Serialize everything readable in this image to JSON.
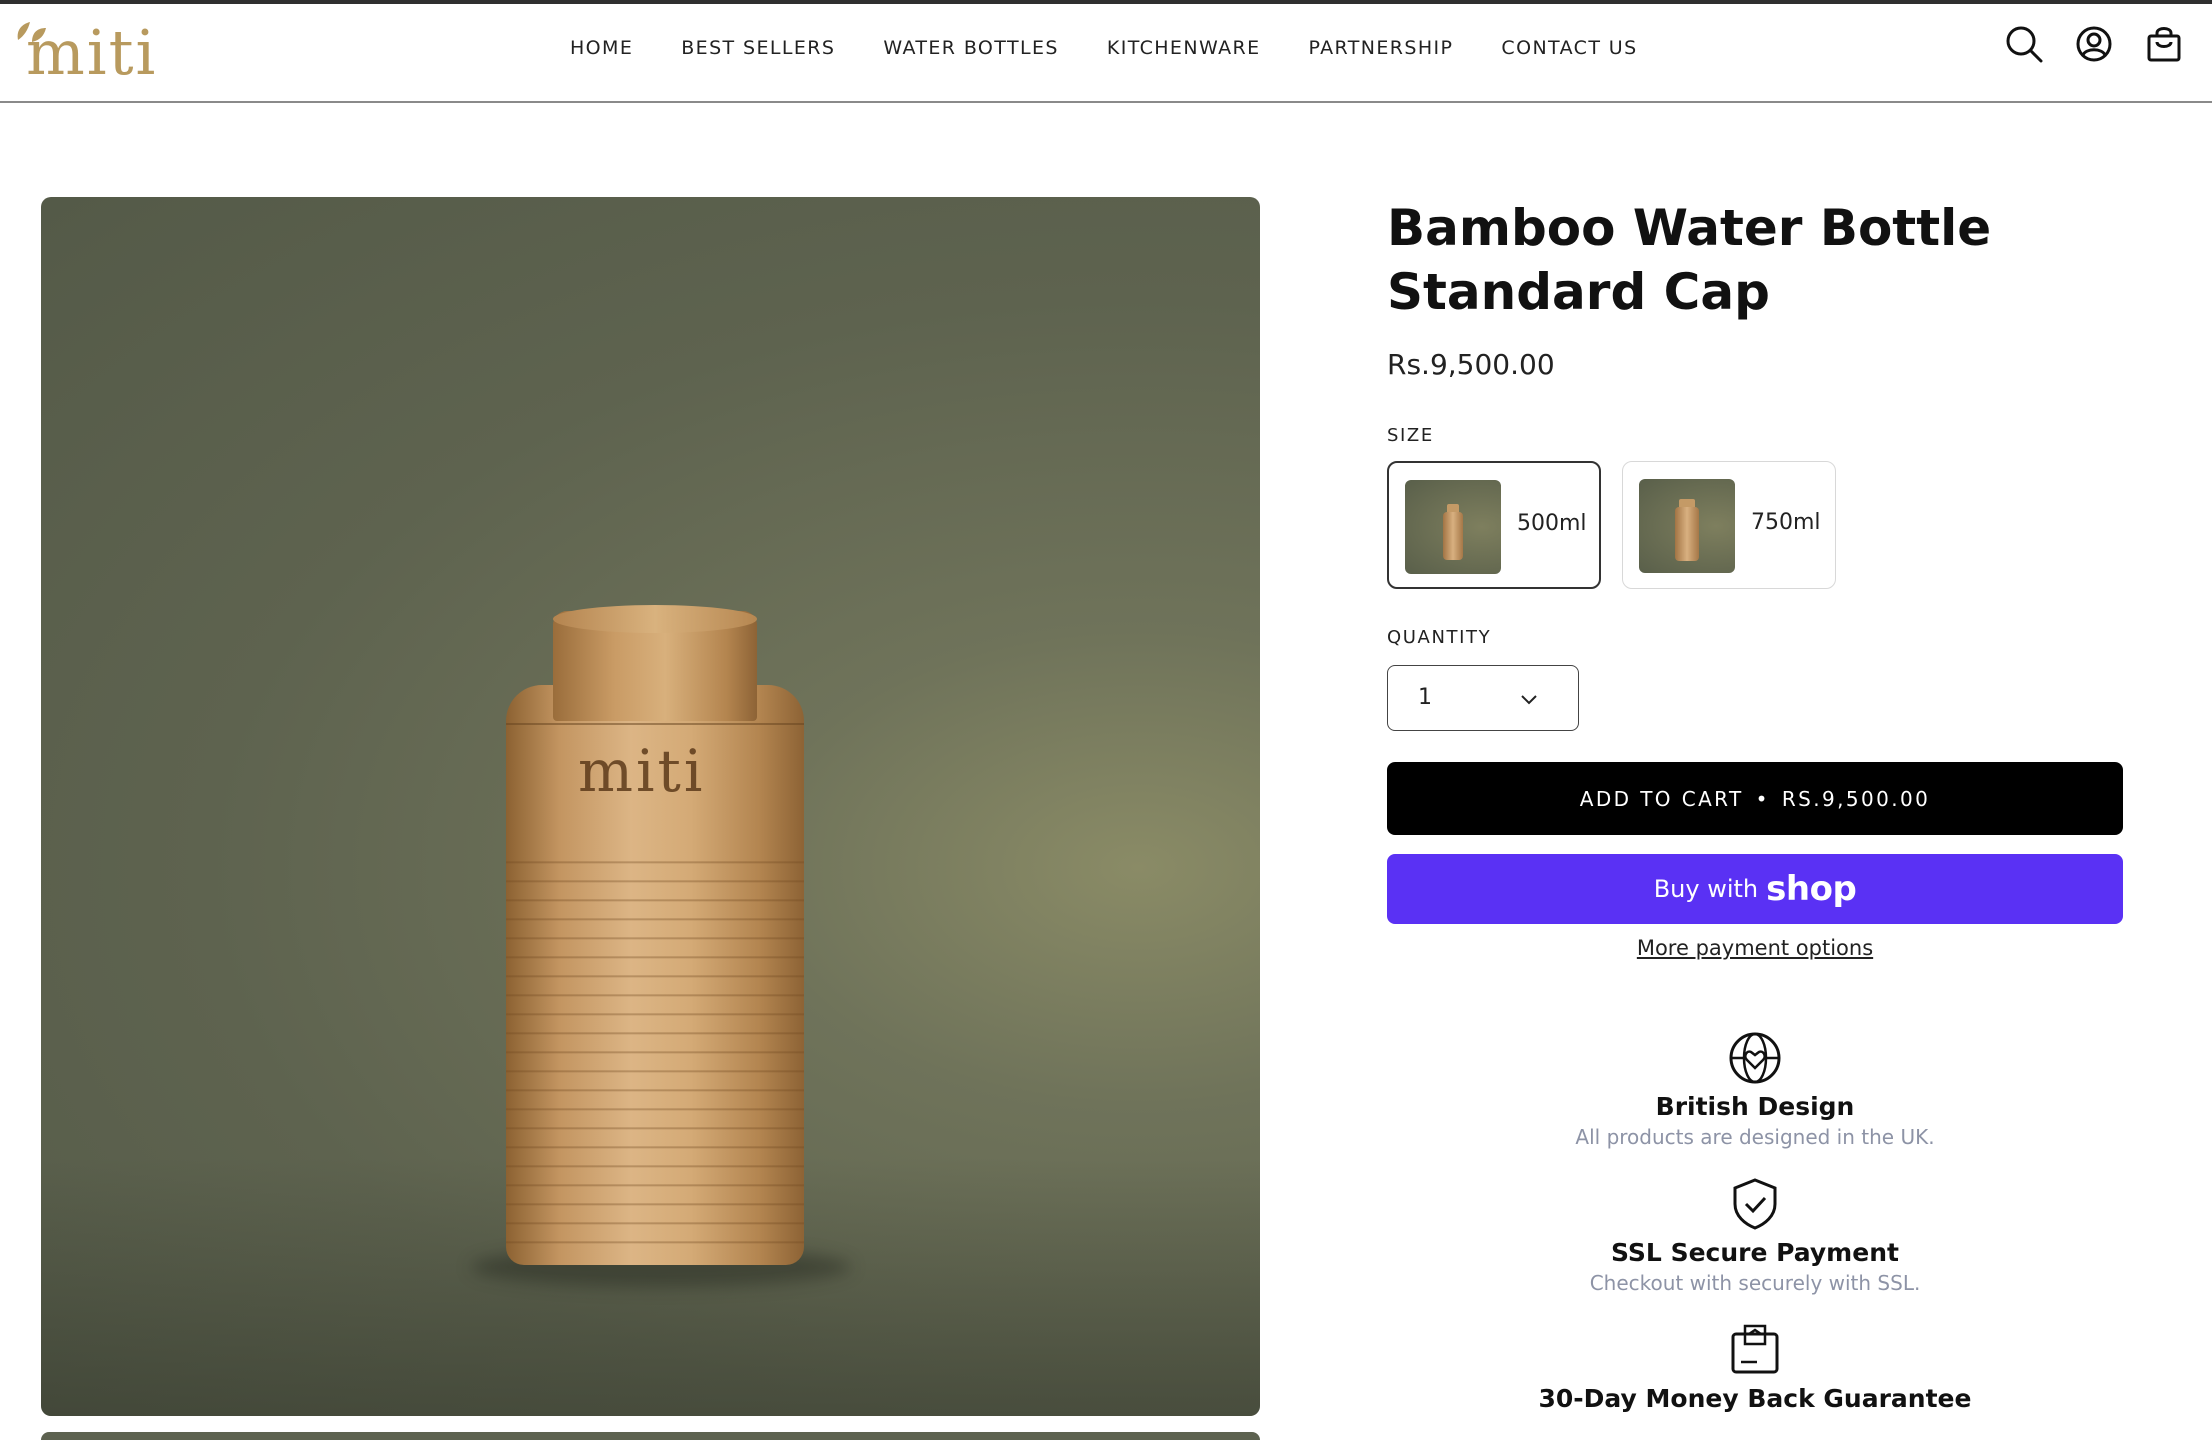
{
  "header": {
    "logo_text": "miti",
    "nav": [
      "HOME",
      "BEST SELLERS",
      "WATER BOTTLES",
      "KITCHENWARE",
      "PARTNERSHIP",
      "CONTACT US"
    ],
    "icons": [
      "search-icon",
      "account-icon",
      "cart-icon"
    ]
  },
  "gallery": {
    "bottle_logo": "miti"
  },
  "product": {
    "title_line1": "Bamboo Water Bottle",
    "title_line2": "Standard Cap",
    "price": "Rs.9,500.00",
    "size_label": "SIZE",
    "sizes": [
      {
        "label": "500ml",
        "selected": true
      },
      {
        "label": "750ml",
        "selected": false
      }
    ],
    "quantity_label": "QUANTITY",
    "quantity_value": "1",
    "add_to_cart": "ADD TO CART",
    "add_to_cart_sep": "•",
    "add_to_cart_price": "RS.9,500.00",
    "buy_with": "Buy with",
    "shop": "shop",
    "more_payment": "More payment options"
  },
  "features": [
    {
      "icon": "globe-heart-icon",
      "title": "British Design",
      "subtitle": "All products are designed in the UK."
    },
    {
      "icon": "shield-check-icon",
      "title": "SSL Secure Payment",
      "subtitle": "Checkout with securely with SSL."
    },
    {
      "icon": "box-return-icon",
      "title": "30-Day Money Back Guarantee",
      "subtitle": ""
    }
  ],
  "colors": {
    "accent_shop": "#5a31f4",
    "logo": "#b89a5e",
    "button_dark": "#000000"
  }
}
